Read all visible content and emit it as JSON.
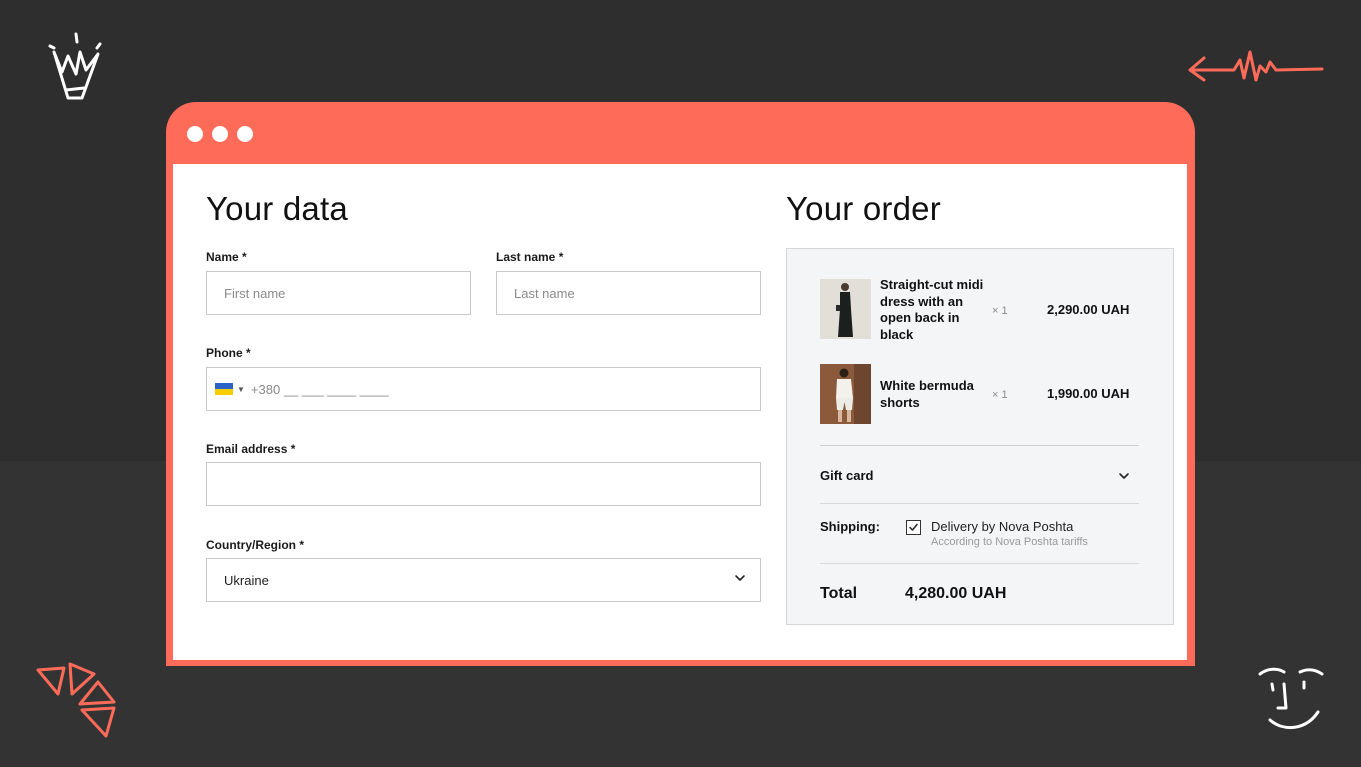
{
  "colors": {
    "accent": "#ff6b59",
    "background": "#2e2e2e",
    "panel": "#ffffff",
    "order_panel": "#f4f5f7"
  },
  "form": {
    "title": "Your data",
    "name": {
      "label": "Name *",
      "placeholder": "First name"
    },
    "last_name": {
      "label": "Last name *",
      "placeholder": "Last name"
    },
    "phone": {
      "label": "Phone *",
      "country_flag": "ukraine-flag-icon",
      "placeholder": "+380 __ ___ ____ ____"
    },
    "email": {
      "label": "Email address *",
      "value": ""
    },
    "country": {
      "label": "Country/Region *",
      "value": "Ukraine"
    }
  },
  "order": {
    "title": "Your order",
    "items": [
      {
        "name": "Straight-cut midi dress with an open back in black",
        "qty": "× 1",
        "price": "2,290.00 UAH"
      },
      {
        "name": "White bermuda shorts",
        "qty": "× 1",
        "price": "1,990.00 UAH"
      }
    ],
    "gift_card_label": "Gift card",
    "shipping_label": "Shipping:",
    "shipping_option": "Delivery by Nova Poshta",
    "shipping_note": "According to Nova Poshta tariffs",
    "shipping_checked": true,
    "total_label": "Total",
    "total_value": "4,280.00 UAH"
  },
  "decorations": [
    "crown-doodle-icon",
    "arrow-zigzag-doodle-icon",
    "fan-doodle-icon",
    "face-doodle-icon"
  ]
}
